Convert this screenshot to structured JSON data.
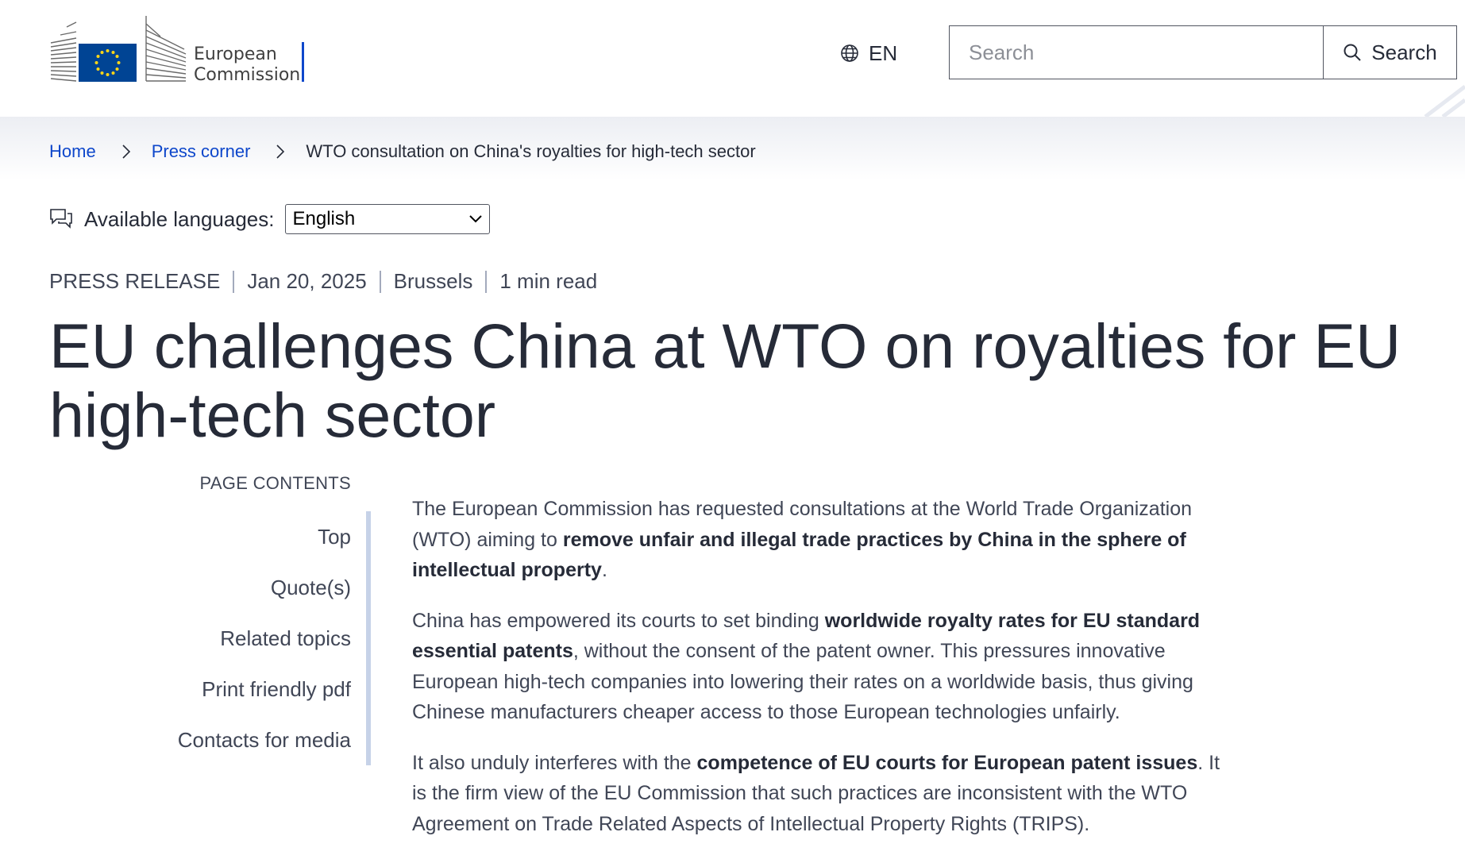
{
  "header": {
    "logo_line1": "European",
    "logo_line2": "Commission",
    "language_code": "EN",
    "search_placeholder": "Search",
    "search_button_label": "Search"
  },
  "breadcrumb": {
    "home": "Home",
    "press_corner": "Press corner",
    "current": "WTO consultation on China's royalties for high-tech sector"
  },
  "languages": {
    "label": "Available languages:",
    "selected": "English"
  },
  "meta": {
    "type": "PRESS RELEASE",
    "date": "Jan 20, 2025",
    "location": "Brussels",
    "read_time": "1 min read"
  },
  "title": "EU challenges China at WTO on royalties for EU high-tech sector",
  "page_contents": {
    "heading": "PAGE CONTENTS",
    "items": [
      "Top",
      "Quote(s)",
      "Related topics",
      "Print friendly pdf",
      "Contacts for media"
    ]
  },
  "article": {
    "p1": {
      "text1": "The European Commission has requested consultations at the World Trade Organization (WTO) aiming to ",
      "bold1": "remove unfair and illegal trade practices by China in the sphere of intellectual property",
      "text2": "."
    },
    "p2": {
      "text1": "China has empowered its courts to set binding ",
      "bold1": "worldwide royalty rates for EU standard essential patents",
      "text2": ", without the consent of the patent owner. This pressures innovative European high-tech companies into lowering their rates on a worldwide basis, thus giving Chinese manufacturers cheaper access to those European technologies unfairly."
    },
    "p3": {
      "text1": "It also unduly interferes with the ",
      "bold1": "competence of EU courts for European patent issues",
      "text2": ". It is the firm view of the EU Commission that such practices are inconsistent with the WTO Agreement on Trade Related Aspects of Intellectual Property Rights (TRIPS)."
    }
  },
  "colors": {
    "link_blue": "#0e47cb",
    "text_dark": "#262b38",
    "flag_blue": "#004494",
    "flag_star": "#ffd617"
  }
}
